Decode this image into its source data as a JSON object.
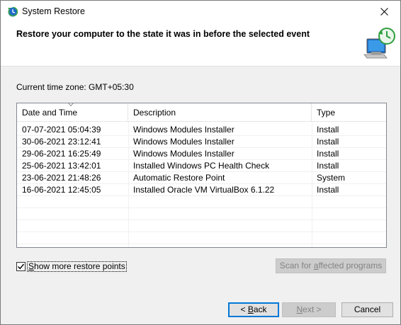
{
  "window": {
    "title": "System Restore",
    "header": "Restore your computer to the state it was in before the selected event",
    "timezone": "Current time zone: GMT+05:30"
  },
  "table": {
    "columns": [
      "Date and Time",
      "Description",
      "Type"
    ],
    "sort_column": "Date and Time",
    "rows": [
      {
        "date": "07-07-2021 05:04:39",
        "description": "Windows Modules Installer",
        "type": "Install"
      },
      {
        "date": "30-06-2021 23:12:41",
        "description": "Windows Modules Installer",
        "type": "Install"
      },
      {
        "date": "29-06-2021 16:25:49",
        "description": "Windows Modules Installer",
        "type": "Install"
      },
      {
        "date": "25-06-2021 13:42:01",
        "description": "Installed Windows PC Health Check",
        "type": "Install"
      },
      {
        "date": "23-06-2021 21:48:26",
        "description": "Automatic Restore Point",
        "type": "System"
      },
      {
        "date": "16-06-2021 12:45:05",
        "description": "Installed Oracle VM VirtualBox 6.1.22",
        "type": "Install"
      }
    ]
  },
  "options": {
    "show_more": {
      "pre": "",
      "mnemonic": "S",
      "post": "how more restore points",
      "checked": true
    }
  },
  "buttons": {
    "scan": {
      "pre": "Scan for ",
      "mnemonic": "a",
      "post": "ffected programs",
      "enabled": false
    },
    "back": {
      "pre": "< ",
      "mnemonic": "B",
      "post": "ack",
      "enabled": true
    },
    "next": {
      "pre": "",
      "mnemonic": "N",
      "post": "ext >",
      "enabled": false
    },
    "cancel": {
      "pre": "",
      "mnemonic": "",
      "post": "Cancel",
      "enabled": true
    }
  },
  "colors": {
    "accent": "#0078d7",
    "window_bg": "#f0f0f0",
    "header_bg": "#ffffff"
  },
  "icons": {
    "title": "system-restore-icon",
    "header": "restore-clock-computer-icon",
    "close": "close-icon"
  }
}
